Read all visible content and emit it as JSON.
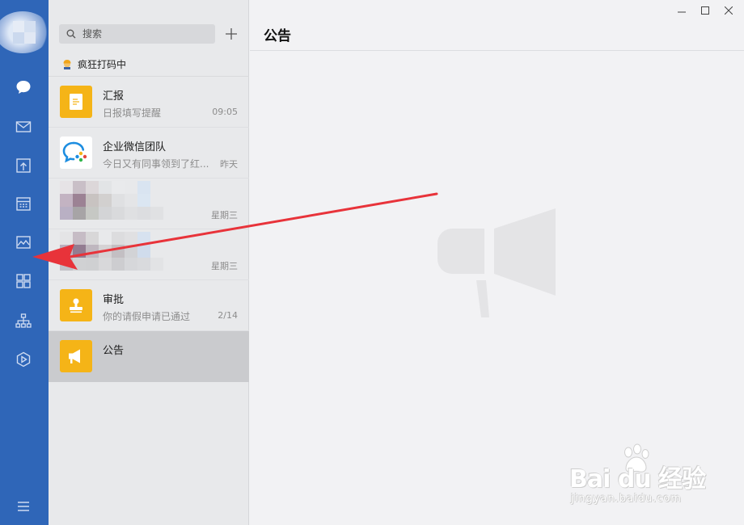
{
  "search": {
    "placeholder": "搜索"
  },
  "status": {
    "text": "疯狂打码中"
  },
  "chats": [
    {
      "name": "汇报",
      "preview": "日报填写提醒",
      "time": "09:05"
    },
    {
      "name": "企业微信团队",
      "preview": "今日又有同事领到了红...",
      "time": "昨天"
    },
    {
      "name": "",
      "preview": "",
      "time": "星期三"
    },
    {
      "name": "",
      "preview": "",
      "time": "星期三"
    },
    {
      "name": "审批",
      "preview": "你的请假申请已通过",
      "time": "2/14"
    },
    {
      "name": "公告",
      "preview": "",
      "time": ""
    }
  ],
  "main": {
    "title": "公告"
  },
  "watermark": {
    "brand": "Bai du 经验",
    "url": "jingyan.baidu.com"
  },
  "colors": {
    "nav_bg": "#2f66b8",
    "app_icon_orange": "#f5b417",
    "arrow_red": "#e8333a",
    "selected_row": "#cacbce"
  },
  "icons": {
    "nav": [
      "chat-bubble-icon",
      "mail-icon",
      "document-upload-icon",
      "calendar-icon",
      "image-icon",
      "grid-apps-icon",
      "org-chart-icon",
      "hexagon-play-icon",
      "menu-icon"
    ],
    "window": [
      "minimize-icon",
      "maximize-icon",
      "close-icon"
    ]
  }
}
